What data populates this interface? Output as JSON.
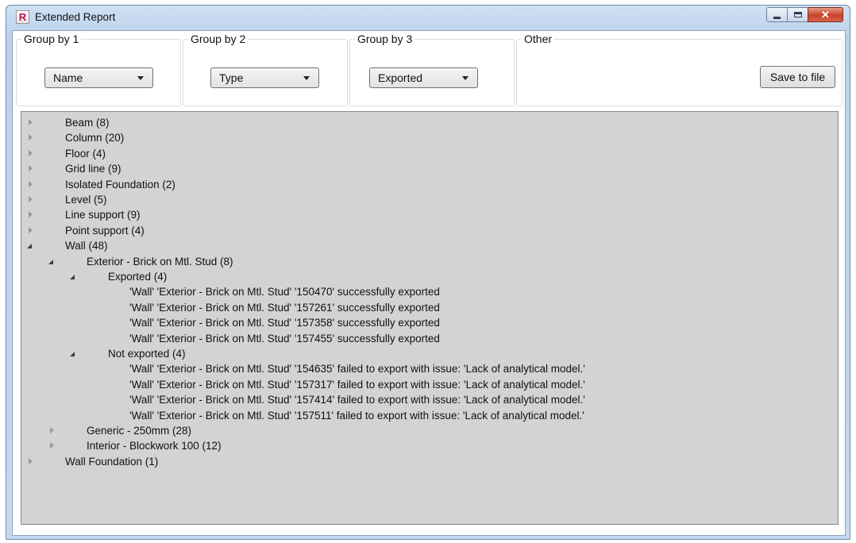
{
  "window": {
    "title": "Extended Report",
    "icon_letter": "R",
    "close_glyph": "✕"
  },
  "groups": {
    "group1": {
      "label": "Group by 1",
      "selected": "Name"
    },
    "group2": {
      "label": "Group by 2",
      "selected": "Type"
    },
    "group3": {
      "label": "Group by 3",
      "selected": "Exported"
    },
    "other": {
      "label": "Other",
      "save_label": "Save to file"
    }
  },
  "tree": {
    "items": [
      {
        "text": "Beam (8)",
        "level": 0,
        "state": "collapsed"
      },
      {
        "text": "Column (20)",
        "level": 0,
        "state": "collapsed"
      },
      {
        "text": "Floor (4)",
        "level": 0,
        "state": "collapsed"
      },
      {
        "text": "Grid line (9)",
        "level": 0,
        "state": "collapsed"
      },
      {
        "text": "Isolated Foundation (2)",
        "level": 0,
        "state": "collapsed"
      },
      {
        "text": "Level (5)",
        "level": 0,
        "state": "collapsed"
      },
      {
        "text": "Line support (9)",
        "level": 0,
        "state": "collapsed"
      },
      {
        "text": "Point support (4)",
        "level": 0,
        "state": "collapsed"
      },
      {
        "text": "Wall (48)",
        "level": 0,
        "state": "expanded"
      },
      {
        "text": "Exterior - Brick on Mtl. Stud (8)",
        "level": 1,
        "state": "expanded"
      },
      {
        "text": "Exported (4)",
        "level": 2,
        "state": "expanded"
      },
      {
        "text": "'Wall' 'Exterior - Brick on Mtl. Stud' '150470' successfully exported",
        "level": 3,
        "state": "leaf"
      },
      {
        "text": "'Wall' 'Exterior - Brick on Mtl. Stud' '157261' successfully exported",
        "level": 3,
        "state": "leaf"
      },
      {
        "text": "'Wall' 'Exterior - Brick on Mtl. Stud' '157358' successfully exported",
        "level": 3,
        "state": "leaf"
      },
      {
        "text": "'Wall' 'Exterior - Brick on Mtl. Stud' '157455' successfully exported",
        "level": 3,
        "state": "leaf"
      },
      {
        "text": "Not exported (4)",
        "level": 2,
        "state": "expanded"
      },
      {
        "text": "'Wall' 'Exterior - Brick on Mtl. Stud' '154635' failed to export with issue: 'Lack of analytical model.'",
        "level": 3,
        "state": "leaf"
      },
      {
        "text": "'Wall' 'Exterior - Brick on Mtl. Stud' '157317' failed to export with issue: 'Lack of analytical model.'",
        "level": 3,
        "state": "leaf"
      },
      {
        "text": "'Wall' 'Exterior - Brick on Mtl. Stud' '157414' failed to export with issue: 'Lack of analytical model.'",
        "level": 3,
        "state": "leaf"
      },
      {
        "text": "'Wall' 'Exterior - Brick on Mtl. Stud' '157511' failed to export with issue: 'Lack of analytical model.'",
        "level": 3,
        "state": "leaf"
      },
      {
        "text": "Generic - 250mm (28)",
        "level": 1,
        "state": "collapsed"
      },
      {
        "text": "Interior - Blockwork 100 (12)",
        "level": 1,
        "state": "collapsed"
      },
      {
        "text": "Wall Foundation (1)",
        "level": 0,
        "state": "collapsed"
      }
    ]
  }
}
